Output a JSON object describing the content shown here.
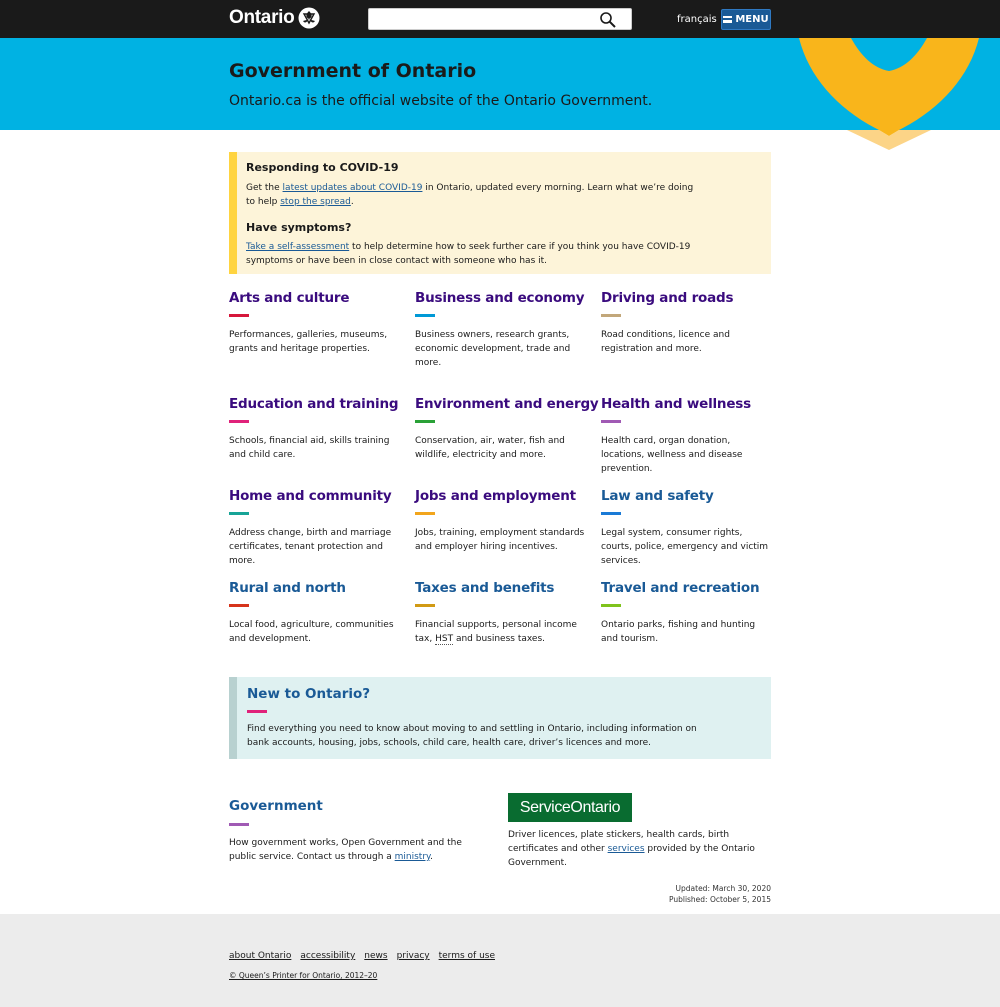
{
  "header": {
    "logo_text": "Ontario",
    "search_placeholder": "",
    "language_link": "français",
    "menu_label": "MENU"
  },
  "hero": {
    "title": "Government of Ontario",
    "subtitle": "Ontario.ca is the official website of the Ontario Government."
  },
  "covid": {
    "title": "Responding to COVID-19",
    "p1_prefix": "Get the ",
    "p1_link": "latest updates about COVID-19",
    "p1_middle": " in Ontario, updated every morning. Learn what we’re doing to help ",
    "p1_link2": "stop the spread",
    "p1_suffix": ".",
    "symptoms_title": "Have symptoms?",
    "p2_link": "Take a self-assessment",
    "p2_suffix": " to help determine how to seek further care if you think you have COVID-19 symptoms or have been in close contact with someone who has it."
  },
  "topics": [
    {
      "title": "Arts and culture",
      "desc": "Performances, galleries, museums, grants and heritage properties.",
      "color": "#d6173b",
      "style": "purple"
    },
    {
      "title": "Business and economy",
      "desc": "Business owners, research grants, economic development, trade and more.",
      "color": "#0099d6",
      "style": "purple"
    },
    {
      "title": "Driving and roads",
      "desc": "Road conditions, licence and registration and more.",
      "color": "#c2a77a",
      "style": "purple"
    },
    {
      "title": "Education and training",
      "desc": "Schools, financial aid, skills training and child care.",
      "color": "#e0227a",
      "style": "purple"
    },
    {
      "title": "Environment and energy",
      "desc": "Conservation, air, water, fish and wildlife, electricity and more.",
      "color": "#2aa137",
      "style": "purple"
    },
    {
      "title": "Health and wellness",
      "desc": "Health card, organ donation, locations, wellness and disease prevention.",
      "color": "#a05ab4",
      "style": "purple"
    },
    {
      "title": "Home and community",
      "desc": "Address change, birth and marriage certificates, tenant protection and more.",
      "color": "#17a497",
      "style": "purple"
    },
    {
      "title": "Jobs and employment",
      "desc": "Jobs, training, employment standards and employer hiring incentives.",
      "color": "#f2a51c",
      "style": "purple"
    },
    {
      "title": "Law and safety",
      "desc": "Legal system, consumer rights, courts, police, emergency and victim services.",
      "color": "#1a7ad6",
      "style": "blue"
    },
    {
      "title": "Rural and north",
      "desc": "Local food, agriculture, communities and development.",
      "color": "#d6341b",
      "style": "blue"
    },
    {
      "title": "Taxes and benefits",
      "desc_prefix": "Financial supports, personal income tax, ",
      "desc_abbr": "HST",
      "desc_suffix": " and business taxes.",
      "color": "#d19a14",
      "style": "blue"
    },
    {
      "title": "Travel and recreation",
      "desc": "Ontario parks, fishing and hunting and tourism.",
      "color": "#7fc31c",
      "style": "blue"
    }
  ],
  "new_to_ontario": {
    "title": "New to Ontario?",
    "desc": "Find everything you need to know about moving to and settling in Ontario, including information on bank accounts, housing, jobs, schools, child care, health care, driver’s licences and more."
  },
  "government": {
    "title": "Government",
    "desc_prefix": "How government works, Open Government and the public service. Contact us through a ",
    "desc_link": "ministry",
    "desc_suffix": "."
  },
  "service_ontario": {
    "logo_text": "ServiceOntario",
    "desc_prefix": "Driver licences, plate stickers, health cards, birth certificates and other ",
    "desc_link": "services",
    "desc_suffix": " provided by the Ontario Government."
  },
  "dates": {
    "updated": "Updated: March 30, 2020",
    "published": "Published: October 5, 2015"
  },
  "footer": {
    "links": [
      "about Ontario",
      "accessibility",
      "news",
      "privacy",
      "terms of use"
    ],
    "copyright": "© Queen’s Printer for Ontario, 2012–20"
  },
  "colors": {
    "topbar": "#1a1a1a",
    "hero": "#00b2e3",
    "hero_deco": "#f9b51b",
    "heading_purple": "#3a0b7e",
    "heading_blue": "#1a5a96",
    "menu_button": "#1a5a96"
  }
}
